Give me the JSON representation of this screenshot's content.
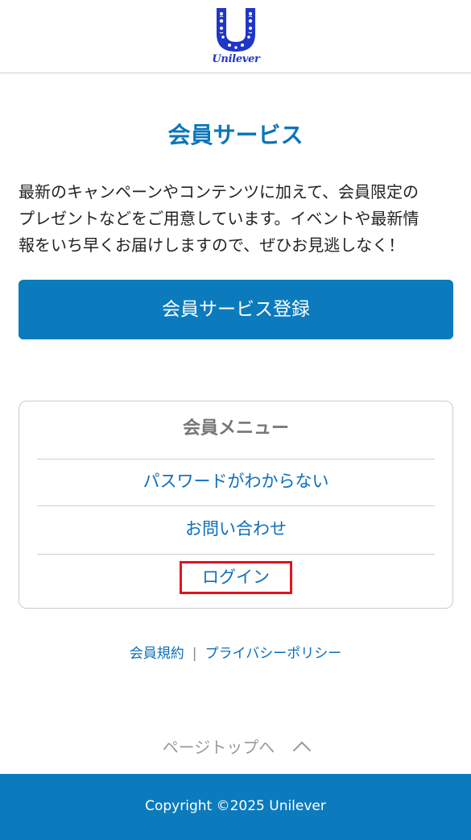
{
  "header": {
    "logo_text": "Unilever",
    "logo_icon": "unilever-logo-icon",
    "brand_color": "#1f36c7"
  },
  "main": {
    "title": "会員サービス",
    "intro_lines": [
      "最新のキャンペーンやコンテンツに加えて、会員限定の",
      "プレゼントなどをご用意しています。イベントや最新情",
      "報をいち早くお届けしますので、ぜひお見逃しなく！"
    ],
    "register_label": "会員サービス登録",
    "accent_color": "#0b7bbd"
  },
  "member_menu": {
    "title": "会員メニュー",
    "items": [
      {
        "label": "パスワードがわからない"
      },
      {
        "label": "お問い合わせ"
      },
      {
        "label": "ログイン",
        "highlight_color": "#e0141e"
      }
    ]
  },
  "footer": {
    "links": [
      {
        "label": "会員規約"
      },
      {
        "label": "プライバシーポリシー"
      }
    ],
    "separator": "|",
    "page_top_label": "ページトップへ",
    "page_top_icon": "chevron-up-icon",
    "copyright": "Copyright ©2025 Unilever"
  }
}
